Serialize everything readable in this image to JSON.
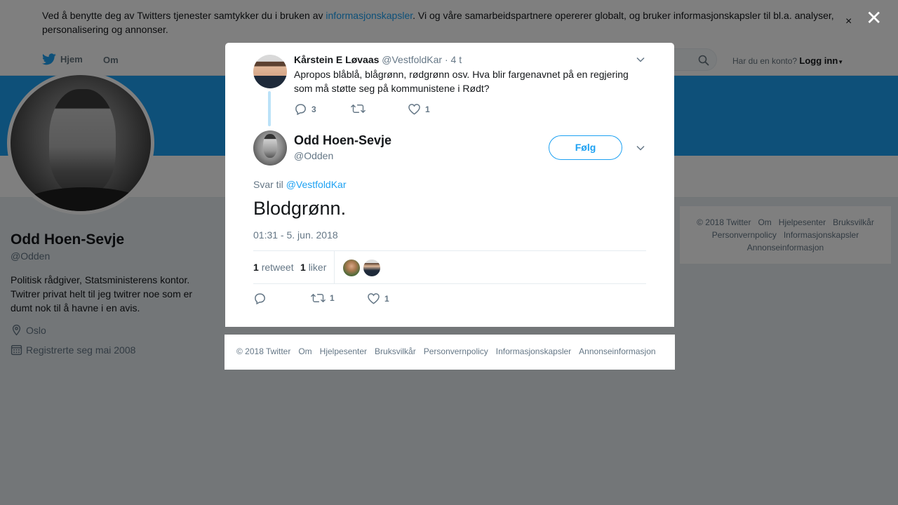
{
  "cookie_banner": {
    "text_before": "Ved å benytte deg av Twitters tjenester samtykker du i bruken av ",
    "link": "informasjonskapsler",
    "text_after": ". Vi og våre samarbeidspartnere opererer globalt, og bruker informasjonskapsler til bl.a. analyser, personalisering og annonser.",
    "close": "×"
  },
  "topnav": {
    "home": "Hjem",
    "about": "Om",
    "login_question": "Har du en konto?",
    "login_link": "Logg inn"
  },
  "profile": {
    "name": "Odd Hoen-Sevje",
    "handle": "@Odden",
    "bio": "Politisk rådgiver, Statsministerens kontor. Twitrer privat helt til jeg twitrer noe som er dumt nok til å havne i en avis.",
    "location": "Oslo",
    "joined": "Registrerte seg mai 2008"
  },
  "side_footer": {
    "items": [
      "© 2018 Twitter",
      "Om",
      "Hjelpesenter",
      "Bruksvilkår",
      "Personvernpolicy",
      "Informasjonskapsler",
      "Annonseinformasjon"
    ]
  },
  "overlay": {
    "close": "✕"
  },
  "modal": {
    "parent_tweet": {
      "name": "Kårstein E Løvaas",
      "handle": "@VestfoldKar",
      "time": "· 4 t",
      "text": "Apropos blåblå, blågrønn, rødgrønn osv. Hva blir fargenavnet på en regjering som må støtte seg på kommunistene i Rødt?",
      "replies": "3",
      "retweets": "",
      "likes": "1"
    },
    "tweet": {
      "name": "Odd Hoen-Sevje",
      "handle": "@Odden",
      "follow": "Følg",
      "reply_label": "Svar til",
      "reply_handle": "@VestfoldKar",
      "text": "Blodgrønn.",
      "date": "01:31 - 5. jun. 2018",
      "retweet_count": "1",
      "retweet_label": "retweet",
      "like_count": "1",
      "like_label": "liker",
      "action_retweets": "1",
      "action_likes": "1"
    }
  },
  "modal_footer": {
    "items": [
      "© 2018 Twitter",
      "Om",
      "Hjelpesenter",
      "Bruksvilkår",
      "Personvernpolicy",
      "Informasjonskapsler",
      "Annonseinformasjon"
    ]
  },
  "colors": {
    "accent": "#1da1f2",
    "muted_text": "#657786",
    "overlay": "rgba(0,0,0,0.5)"
  }
}
